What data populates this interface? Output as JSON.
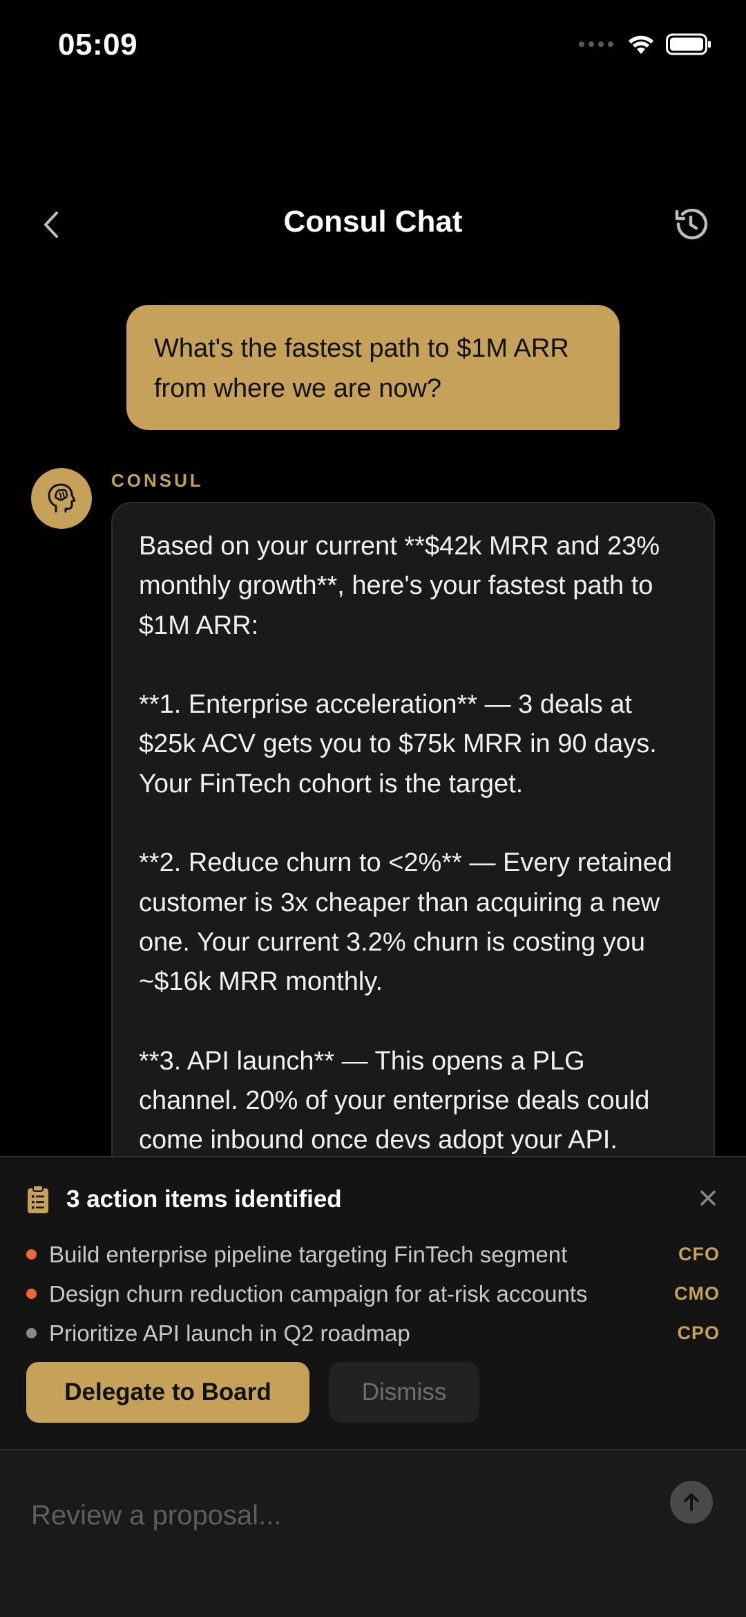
{
  "status": {
    "time": "05:09"
  },
  "header": {
    "title": "Consul Chat"
  },
  "chat": {
    "user_message": "What's the fastest path to $1M ARR from where we are now?",
    "assistant_name": "CONSUL",
    "assistant_message": "Based on your current **$42k MRR and 23% monthly growth**, here's your fastest path to $1M ARR:\n\n**1. Enterprise acceleration** — 3 deals at $25k ACV gets you to $75k MRR in 90 days. Your FinTech cohort is the target.\n\n**2. Reduce churn to <2%** — Every retained customer is 3x cheaper than acquiring a new one. Your current 3.2% churn is costing you ~$16k MRR monthly.\n\n**3. API launch** — This opens a PLG channel. 20% of your enterprise deals could come inbound once devs adopt your API."
  },
  "action_panel": {
    "title": "3 action items identified",
    "items": [
      {
        "text": "Build enterprise pipeline targeting FinTech segment",
        "role": "CFO"
      },
      {
        "text": "Design churn reduction campaign for at-risk accounts",
        "role": "CMO"
      },
      {
        "text": "Prioritize API launch in Q2 roadmap",
        "role": "CPO"
      }
    ],
    "primary_label": "Delegate to Board",
    "secondary_label": "Dismiss"
  },
  "composer": {
    "placeholder": "Review a proposal..."
  },
  "colors": {
    "accent": "#c5a15a",
    "dot_orange": "#f0643a",
    "dot_gray": "#8a8a8a"
  }
}
